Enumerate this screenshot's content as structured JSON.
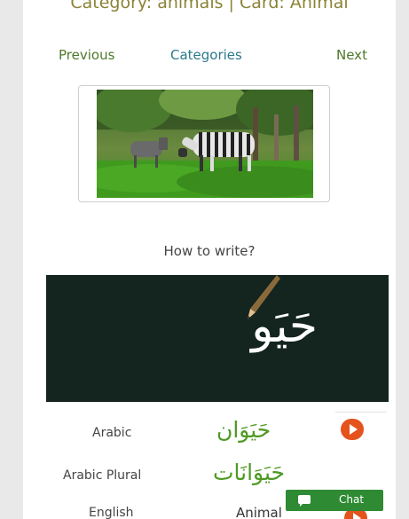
{
  "header": {
    "text": "Category: animals | Card: Animal"
  },
  "nav": {
    "previous": "Previous",
    "categories": "Categories",
    "next": "Next"
  },
  "how_to_write": "How to write?",
  "board": {
    "word": "حَيَو"
  },
  "rows": {
    "arabic": {
      "label": "Arabic",
      "value": "حَيَوَان"
    },
    "arabic_plural": {
      "label": "Arabic Plural",
      "value": "حَيَوَانَات"
    },
    "english": {
      "label": "English",
      "value": "Animal"
    }
  },
  "chat": {
    "label": "Chat"
  },
  "colors": {
    "header": "#8a8336",
    "nav_green": "#4d7a2a",
    "nav_teal": "#2c7a8c",
    "arabic_green": "#4e9a24",
    "play_orange": "#e4531c",
    "board_bg": "#14241e",
    "chat_green": "#2f8a34"
  },
  "icons": {
    "play": "play-icon",
    "chat": "chat-bubble-icon",
    "pencil": "pencil-icon"
  }
}
